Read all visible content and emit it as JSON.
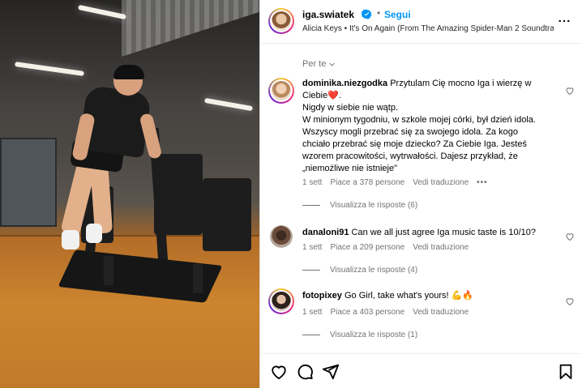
{
  "post": {
    "username": "iga.swiatek",
    "follow_label": "Segui",
    "separator": "•",
    "music": "Alicia Keys • It's On Again (From The Amazing Spider-Man 2 Soundtra…",
    "sort_label": "Per te"
  },
  "comments": [
    {
      "username": "dominika.niezgodka",
      "text": "Przytulam Cię mocno Iga i wierzę w Ciebie❤️.\nNigdy w siebie nie wątp.\nW minionym tygodniu, w szkole mojej córki, był dzień idola. Wszyscy mogli przebrać się za swojego idola. Za kogo chciało przebrać się moje dziecko? Za Ciebie Iga. Jesteś wzorem pracowitości, wytrwałości. Dajesz przykład, że „niemożliwe nie istnieje\"",
      "time": "1 sett",
      "likes": "Piace a 378 persone",
      "translate": "Vedi traduzione",
      "more": "•••",
      "replies": "Visualizza le risposte (6)"
    },
    {
      "username": "danaloni91",
      "text": "Can we all just agree Iga music taste is 10/10?",
      "time": "1 sett",
      "likes": "Piace a 209 persone",
      "translate": "Vedi traduzione",
      "replies": "Visualizza le risposte (4)"
    },
    {
      "username": "fotopixey",
      "text": "Go Girl, take what's yours! 💪🔥",
      "time": "1 sett",
      "likes": "Piace a 403 persone",
      "translate": "Vedi traduzione",
      "replies": "Visualizza le risposte (1)"
    }
  ],
  "icons": {
    "verified": "verified-badge-icon",
    "more": "more-options-icon",
    "like": "heart-icon",
    "comment": "comment-icon",
    "share": "share-icon",
    "save": "bookmark-icon"
  },
  "colors": {
    "link_blue": "#0095f6",
    "muted": "#737373"
  }
}
